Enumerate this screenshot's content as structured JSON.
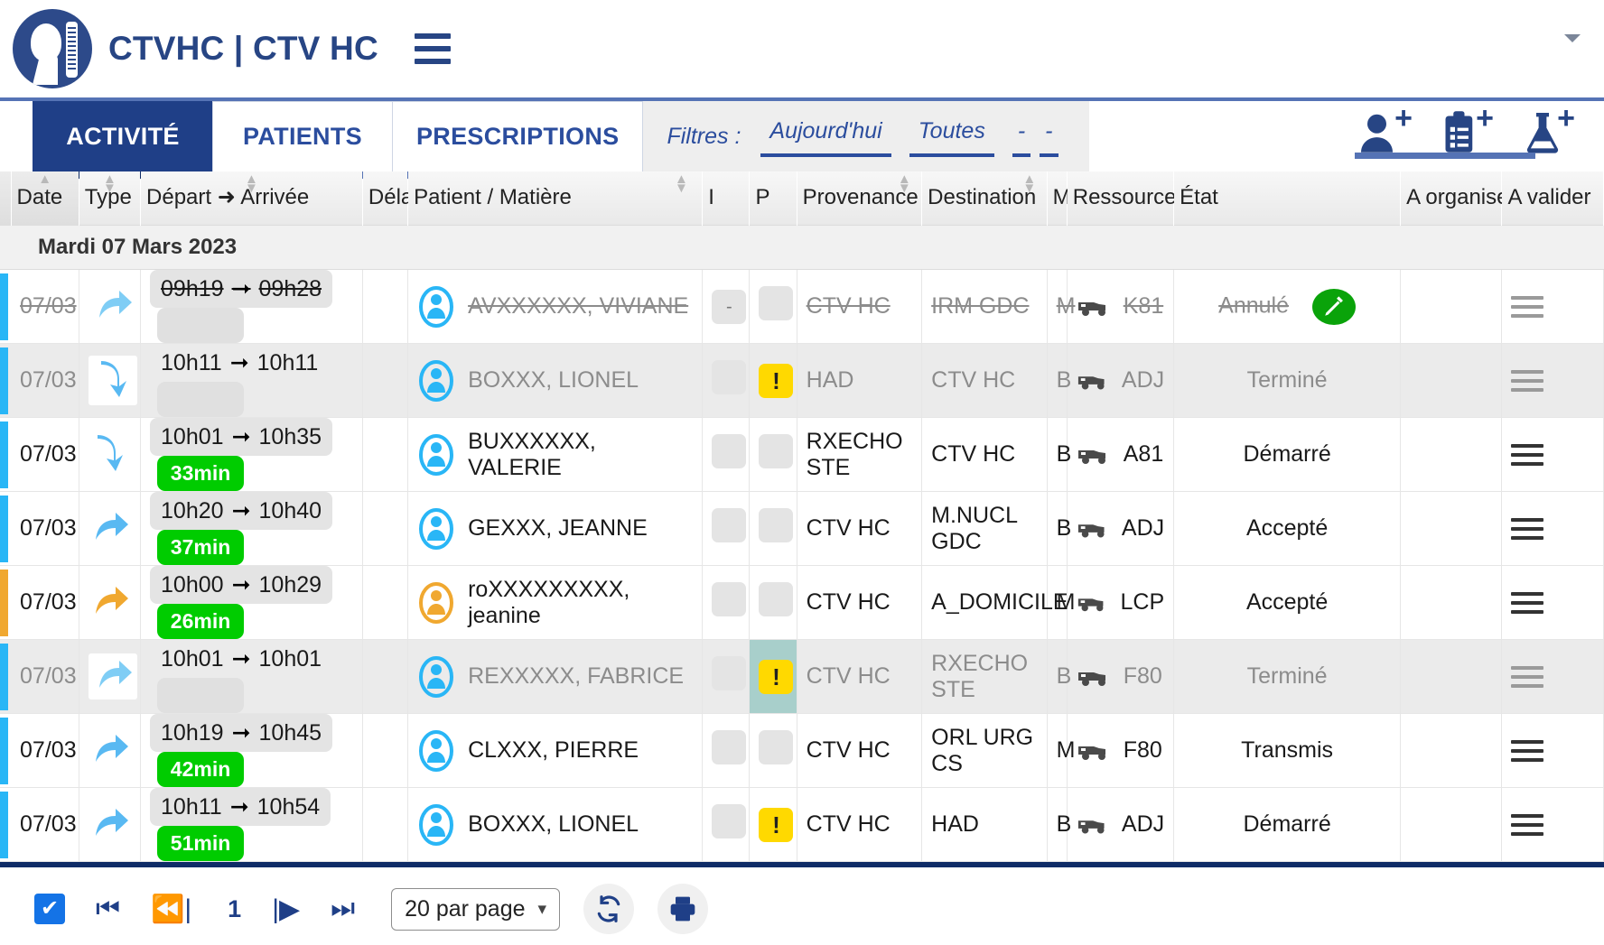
{
  "header": {
    "brand": "CTVHC | CTV HC",
    "logo_alt": "logo",
    "menu_icon": "hamburger-icon",
    "caret_icon": "chevron-down-icon"
  },
  "tabs": [
    {
      "label": "ACTIVITÉ",
      "active": true
    },
    {
      "label": "PATIENTS",
      "active": false
    },
    {
      "label": "PRESCRIPTIONS",
      "active": false
    }
  ],
  "filters": {
    "label": "Filtres :",
    "links": [
      "Aujourd'hui",
      "Toutes"
    ],
    "dash": [
      "-",
      "-"
    ]
  },
  "quick_actions": [
    {
      "name": "add-patient-icon",
      "title": "Nouveau patient"
    },
    {
      "name": "add-prescription-icon",
      "title": "Nouvelle prescription"
    },
    {
      "name": "add-analysis-icon",
      "title": "Nouvelle analyse"
    }
  ],
  "columns": [
    "Date",
    "Type",
    "Départ",
    "Arrivée",
    "Délai",
    "Patient / Matière",
    "I",
    "P",
    "Provenance",
    "Destination",
    "M",
    "Ressources",
    "État",
    "A organiser",
    "A valider"
  ],
  "col_depart_arrow": "➜",
  "day_group": "Mardi 07 Mars 2023",
  "rows": [
    {
      "date": "07/03",
      "type": "forward",
      "type_color": "blue-dim",
      "depart": "09h19",
      "arrivee": "09h28",
      "delai": "",
      "patient": "AVXXXXXX, VIVIANE",
      "avatar_color": "blue",
      "i": "-",
      "p": "",
      "p_warn": false,
      "provenance": "CTV HC",
      "destination": "IRM GDC",
      "m": "M",
      "ressource": "K81",
      "etat": "Annulé",
      "badge": "syringe",
      "style": "strike",
      "accent": "blue",
      "menu": "dim"
    },
    {
      "date": "07/03",
      "type": "return",
      "type_color": "blue",
      "depart": "10h11",
      "arrivee": "10h11",
      "delai": "",
      "patient": "BOXXX, LIONEL",
      "avatar_color": "blue",
      "i": "",
      "p": "!",
      "p_warn": true,
      "provenance": "HAD",
      "destination": "CTV HC",
      "m": "B",
      "ressource": "ADJ",
      "etat": "Terminé",
      "badge": "",
      "style": "muted-alt",
      "accent": "blue",
      "menu": "dim"
    },
    {
      "date": "07/03",
      "type": "return",
      "type_color": "blue",
      "depart": "10h01",
      "arrivee": "10h35",
      "delai": "33min",
      "patient": "BUXXXXXX, VALERIE",
      "avatar_color": "blue",
      "i": "",
      "p": "",
      "p_warn": false,
      "provenance": "RXECHO STE",
      "destination": "CTV HC",
      "m": "B",
      "ressource": "A81",
      "etat": "Démarré",
      "badge": "",
      "style": "normal",
      "accent": "blue",
      "menu": "dark"
    },
    {
      "date": "07/03",
      "type": "forward",
      "type_color": "blue",
      "depart": "10h20",
      "arrivee": "10h40",
      "delai": "37min",
      "patient": "GEXXX, JEANNE",
      "avatar_color": "blue",
      "i": "",
      "p": "",
      "p_warn": false,
      "provenance": "CTV HC",
      "destination": "M.NUCL GDC",
      "m": "B",
      "ressource": "ADJ",
      "etat": "Accepté",
      "badge": "",
      "style": "normal",
      "accent": "blue",
      "menu": "dark"
    },
    {
      "date": "07/03",
      "type": "forward",
      "type_color": "orange",
      "depart": "10h00",
      "arrivee": "10h29",
      "delai": "26min",
      "patient": "roXXXXXXXXX, jeanine",
      "avatar_color": "orange",
      "i": "",
      "p": "",
      "p_warn": false,
      "provenance": "CTV HC",
      "destination": "A_DOMICILE",
      "m": "M",
      "ressource": "LCP",
      "etat": "Accepté",
      "badge": "",
      "style": "normal",
      "accent": "orange",
      "menu": "dark"
    },
    {
      "date": "07/03",
      "type": "forward",
      "type_color": "blue-dim",
      "depart": "10h01",
      "arrivee": "10h01",
      "delai": "",
      "patient": "REXXXXX, FABRICE",
      "avatar_color": "blue",
      "i": "",
      "p": "!",
      "p_warn": true,
      "p_highlight": true,
      "provenance": "CTV HC",
      "destination": "RXECHO STE",
      "m": "B",
      "ressource": "F80",
      "etat": "Terminé",
      "badge": "",
      "style": "muted-alt",
      "accent": "blue",
      "menu": "dim"
    },
    {
      "date": "07/03",
      "type": "forward",
      "type_color": "blue",
      "depart": "10h19",
      "arrivee": "10h45",
      "delai": "42min",
      "patient": "CLXXX, PIERRE",
      "avatar_color": "blue",
      "i": "",
      "p": "",
      "p_warn": false,
      "provenance": "CTV HC",
      "destination": "ORL URG CS",
      "m": "M",
      "ressource": "F80",
      "etat": "Transmis",
      "badge": "",
      "style": "normal",
      "accent": "blue",
      "menu": "dark"
    },
    {
      "date": "07/03",
      "type": "forward",
      "type_color": "blue",
      "depart": "10h11",
      "arrivee": "10h54",
      "delai": "51min",
      "patient": "BOXXX, LIONEL",
      "avatar_color": "blue",
      "i": "",
      "p": "!",
      "p_warn": true,
      "provenance": "CTV HC",
      "destination": "HAD",
      "m": "B",
      "ressource": "ADJ",
      "etat": "Démarré",
      "badge": "",
      "style": "normal",
      "accent": "blue",
      "menu": "dark"
    }
  ],
  "footer": {
    "select_all_icon": "checkbox-checked-icon",
    "first_icon": "first-page-icon",
    "prev_icon": "previous-page-icon",
    "page": "1",
    "next_icon": "next-page-icon",
    "last_icon": "last-page-icon",
    "per_page": "20 par page",
    "refresh_icon": "refresh-icon",
    "print_icon": "print-icon"
  },
  "colors": {
    "brand_blue": "#274584",
    "tab_active": "#1f3f87",
    "accent_blue": "#29b6f6",
    "accent_orange": "#f0a830",
    "delay_green": "#00cc00",
    "warn_yellow": "#ffd900",
    "badge_green": "#0aa30a",
    "p_highlight": "#a8cfcb"
  }
}
